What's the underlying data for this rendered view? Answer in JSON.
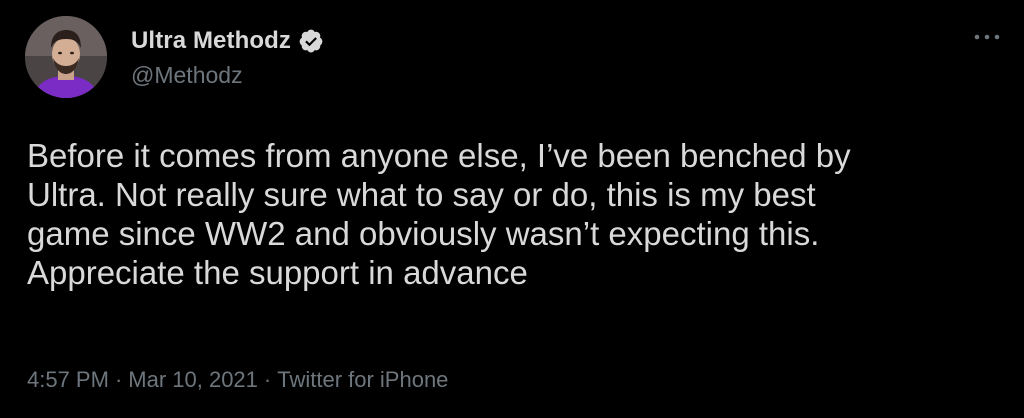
{
  "author": {
    "display_name": "Ultra Methodz",
    "handle": "@Methodz",
    "verified": true
  },
  "tweet": {
    "text_lines": [
      "Before it comes from anyone else, I’ve been benched by",
      "Ultra. Not really sure what to say or do, this is my best",
      "game since WW2 and obviously wasn’t expecting this.",
      "Appreciate the support in advance"
    ]
  },
  "meta": {
    "time": "4:57 PM",
    "separator": "·",
    "date": "Mar 10, 2021",
    "source": "Twitter for iPhone"
  },
  "icons": {
    "verified": "verified-badge-icon",
    "more": "more-options-icon"
  },
  "colors": {
    "background": "#000000",
    "primary_text": "#d9d9d9",
    "secondary_text": "#6e767d",
    "avatar_shirt": "#7a2cc4"
  }
}
